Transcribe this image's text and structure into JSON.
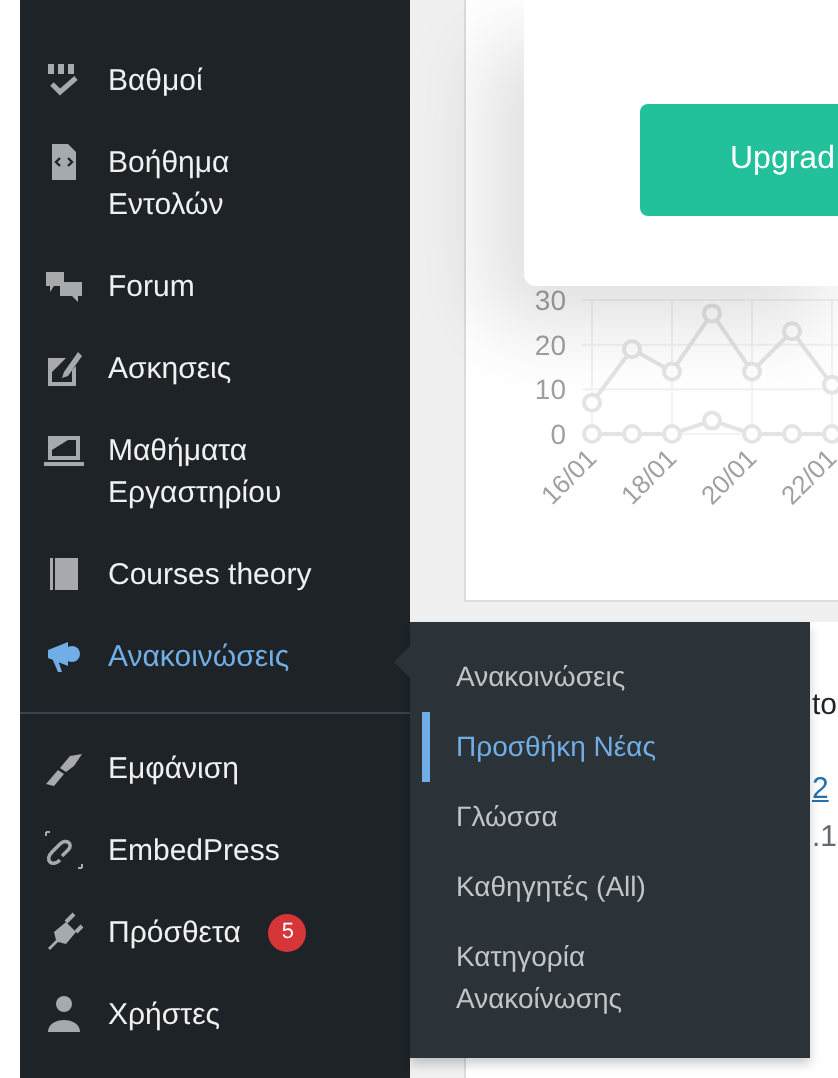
{
  "sidebar": {
    "groups": [
      [
        {
          "label": "Βαθμοί",
          "selected": false
        },
        {
          "label": "Βοήθημα Εντολών",
          "selected": false
        },
        {
          "label": "Forum",
          "selected": false
        },
        {
          "label": "Ασκησεις",
          "selected": false
        },
        {
          "label": "Μαθήματα Εργαστηρίου",
          "selected": false
        },
        {
          "label": "Courses theory",
          "selected": false
        },
        {
          "label": "Ανακοινώσεις",
          "selected": true
        }
      ],
      [
        {
          "label": "Εμφάνιση",
          "selected": false
        },
        {
          "label": "EmbedPress",
          "selected": false
        },
        {
          "label": "Πρόσθετα",
          "selected": false,
          "badge": "5"
        },
        {
          "label": "Χρήστες",
          "selected": false
        }
      ]
    ]
  },
  "flyout": {
    "items": [
      {
        "label": "Ανακοινώσεις",
        "selected": false
      },
      {
        "label": "Προσθήκη Νέας",
        "selected": true
      },
      {
        "label": "Γλώσσα",
        "selected": false
      },
      {
        "label": "Καθηγητές (All)",
        "selected": false
      },
      {
        "label": "Κατηγορία Ανακοίνωσης",
        "selected": false
      }
    ]
  },
  "chart_panel": {
    "chart_data": {
      "type": "line",
      "grid": true,
      "categories": [
        "16/01",
        null,
        "18/01",
        null,
        "20/01",
        null,
        "22/01"
      ],
      "series": [
        {
          "color": "#e4e4e4",
          "marker": "circle",
          "values": [
            7,
            19,
            14,
            27,
            14,
            23,
            11
          ]
        },
        {
          "color": "#e4e4e4",
          "marker": "circle",
          "values": [
            0,
            0,
            0,
            3,
            0,
            0,
            0
          ]
        }
      ],
      "yticks": [
        0,
        10,
        20,
        30
      ],
      "ylim": [
        0,
        30
      ]
    }
  },
  "modal": {
    "button": "Upgrad"
  },
  "lower_panel": {
    "texts": [
      {
        "kind": "heading",
        "text": "to"
      },
      {
        "kind": "link",
        "text": "2"
      },
      {
        "kind": "text",
        "text": ".1"
      }
    ]
  }
}
